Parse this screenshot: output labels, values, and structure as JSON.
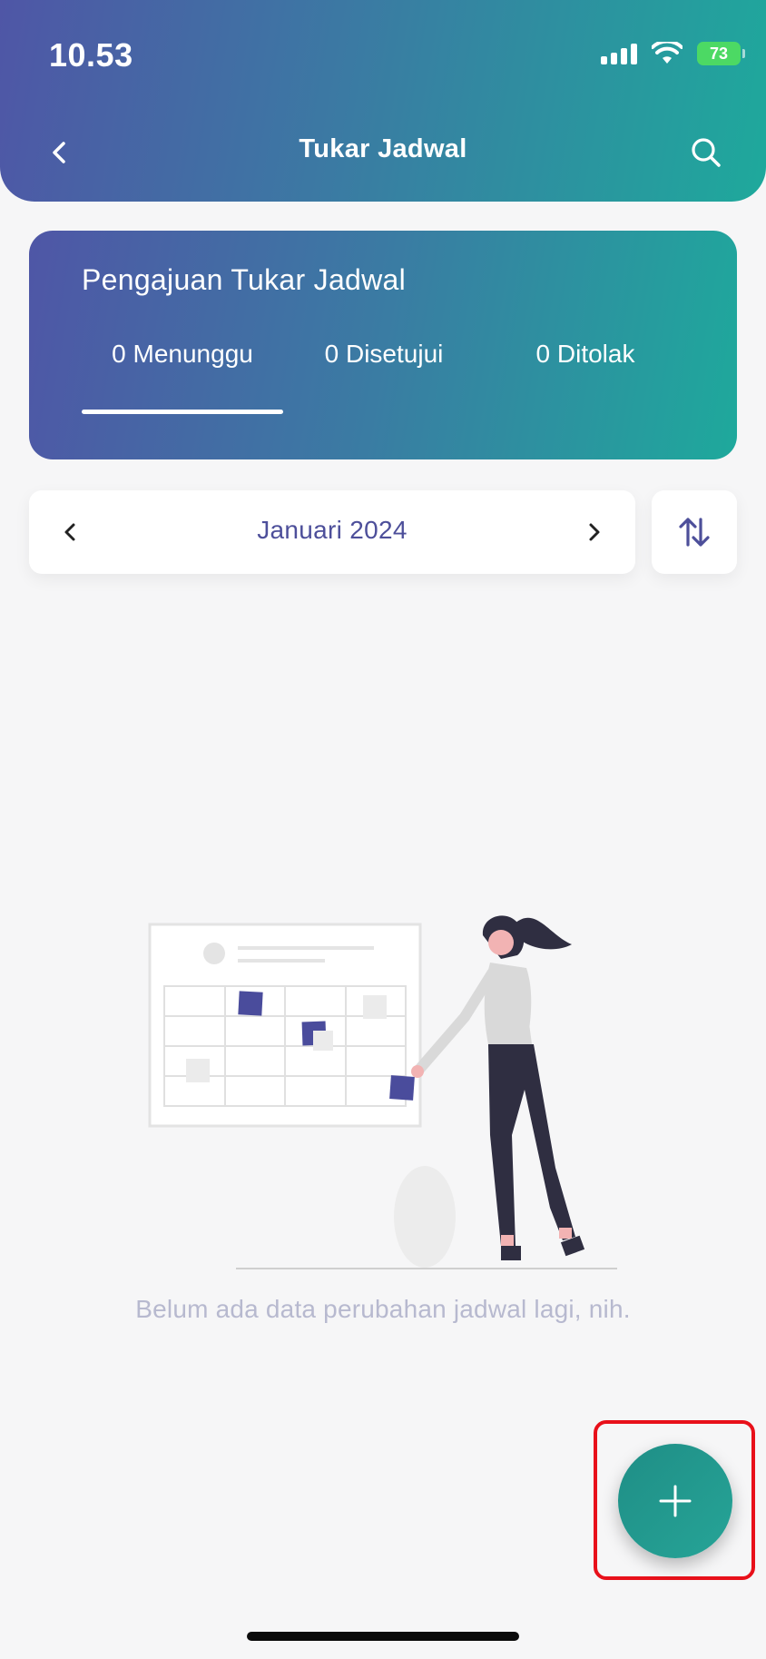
{
  "status_bar": {
    "time": "10.53",
    "battery": "73"
  },
  "header": {
    "title": "Tukar Jadwal",
    "back_icon": "chevron-left-icon",
    "search_icon": "search-icon"
  },
  "summary": {
    "title": "Pengajuan Tukar Jadwal",
    "tabs": [
      {
        "label": "0 Menunggu",
        "active": true
      },
      {
        "label": "0 Disetujui",
        "active": false
      },
      {
        "label": "0 Ditolak",
        "active": false
      }
    ]
  },
  "month_selector": {
    "label": "Januari 2024",
    "prev_icon": "chevron-left-icon",
    "next_icon": "chevron-right-icon",
    "sort_icon": "sort-arrows-icon"
  },
  "empty_state": {
    "message": "Belum ada data perubahan jadwal lagi, nih."
  },
  "fab": {
    "icon": "plus-icon"
  },
  "colors": {
    "gradient_start": "#4f56a6",
    "gradient_end": "#1ea99c",
    "accent_text": "#4d4f9a",
    "fab": "#23998f",
    "highlight": "#e8101a"
  }
}
